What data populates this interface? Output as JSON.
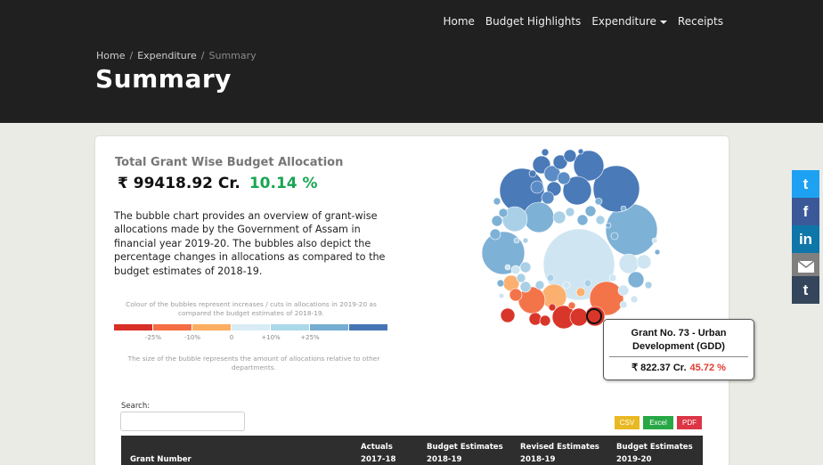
{
  "nav": {
    "items": [
      "Home",
      "Budget Highlights",
      "Expenditure",
      "Receipts"
    ]
  },
  "breadcrumb": {
    "home": "Home",
    "sep": "/",
    "section": "Expenditure",
    "current": "Summary"
  },
  "page": {
    "title": "Summary"
  },
  "card": {
    "title": "Total Grant Wise Budget Allocation",
    "amount": "₹ 99418.92 Cr.",
    "change": "10.14 %",
    "description": "The bubble chart provides an overview of grant-wise allocations made by the Government of Assam in financial year 2019-20. The bubbles also depict the percentage changes in allocations as compared to the budget estimates of 2018-19.",
    "legend_caption": "Colour of the bubbles represent increases / cuts in allocations in 2019-20 as compared the budget estimates of 2018-19.",
    "legend_colors": [
      "#d73027",
      "#f46d43",
      "#fdae61",
      "#d9ecf5",
      "#abd9e9",
      "#74add1",
      "#4575b4"
    ],
    "legend_ticks": [
      "-25%",
      "-10%",
      "0",
      "+10%",
      "+25%"
    ],
    "legend_size_note": "The size of the bubble represents the amount of allocations relative to other departments."
  },
  "tooltip": {
    "name": "Grant No. 73 - Urban Development (GDD)",
    "amount": "₹ 822.37 Cr.",
    "change": "45.72 %"
  },
  "table": {
    "search_label": "Search:",
    "search_value": "",
    "buttons": {
      "csv": "CSV",
      "excel": "Excel",
      "pdf": "PDF"
    },
    "headers": [
      {
        "l1": "",
        "l2": "Grant Number"
      },
      {
        "l1": "Actuals",
        "l2": "2017-18"
      },
      {
        "l1": "Budget Estimates",
        "l2": "2018-19"
      },
      {
        "l1": "Revised Estimates",
        "l2": "2018-19"
      },
      {
        "l1": "Budget Estimates",
        "l2": "2019-20"
      }
    ]
  },
  "social": {
    "twitter": "t",
    "facebook": "f",
    "linkedin": "in",
    "email": "email-icon",
    "tumblr": "t"
  },
  "colors": {
    "topbar": "#202020",
    "increase_strong": "#4575b4",
    "cut_strong": "#d73027",
    "positive_text": "#1aa552",
    "negative_text": "#e23b2e"
  }
}
